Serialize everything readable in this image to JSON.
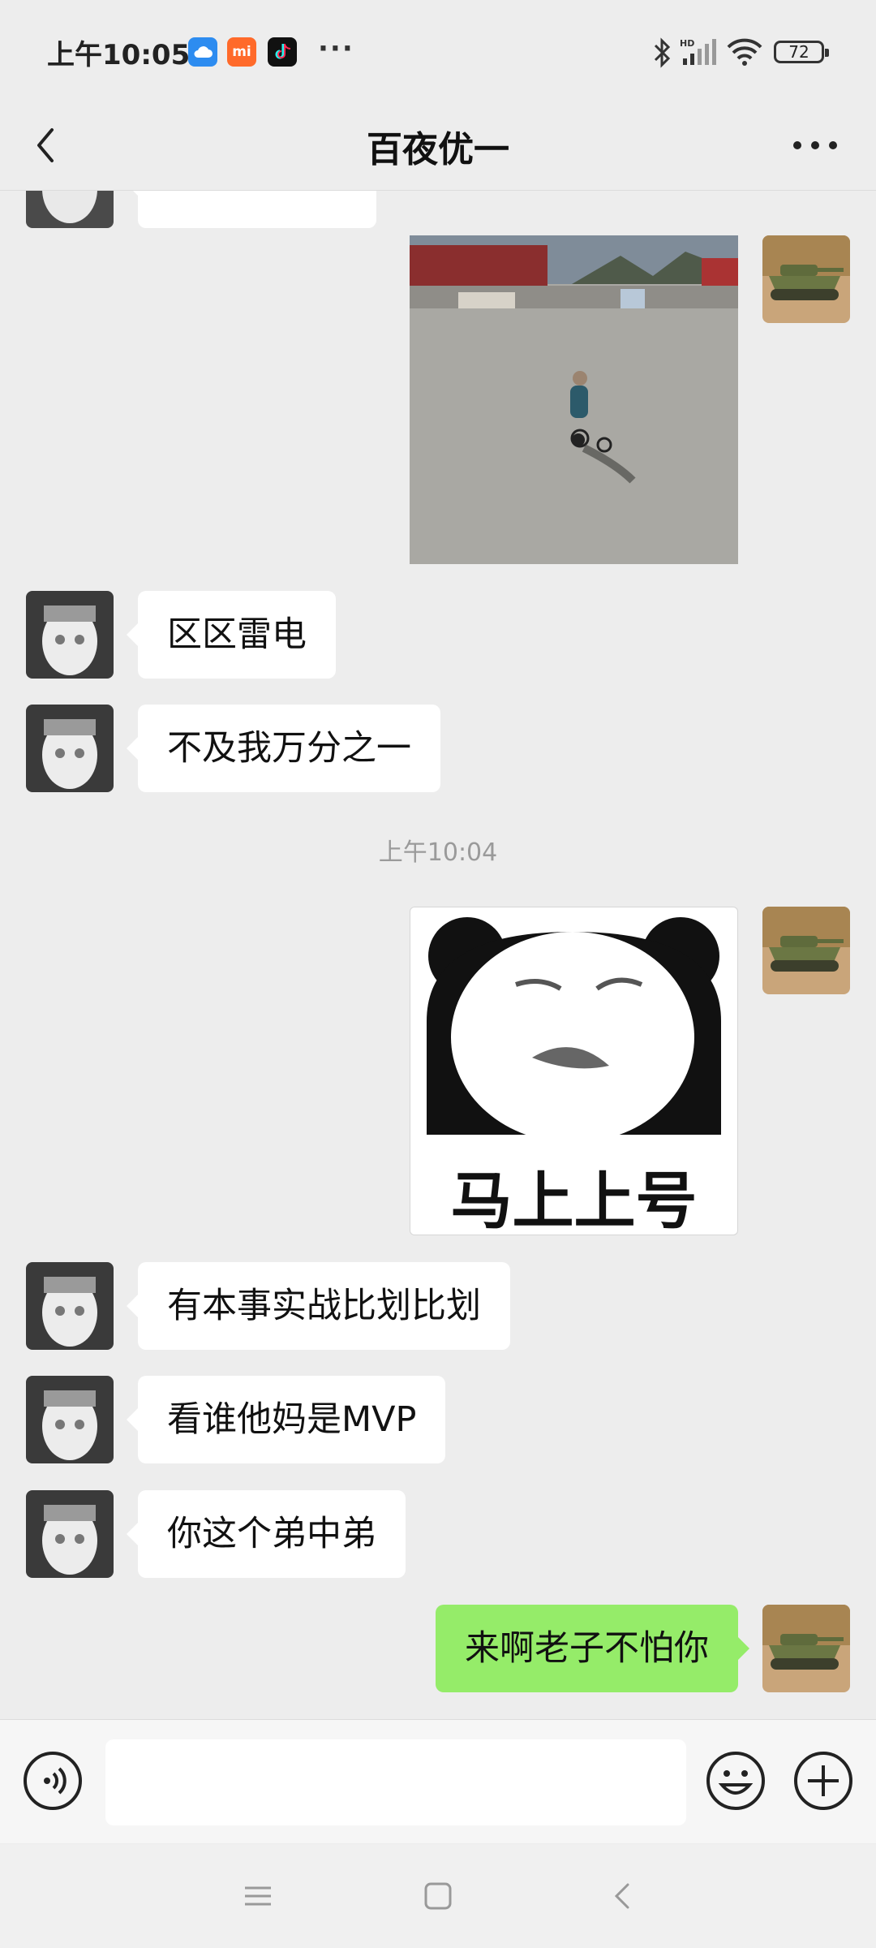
{
  "status_bar": {
    "time": "上午10:05",
    "app_icons": [
      "cloud-icon",
      "mi-icon",
      "tiktok-icon"
    ],
    "mi_label": "mi",
    "battery": "72"
  },
  "header": {
    "title": "百夜优一"
  },
  "messages": [
    {
      "side": "left",
      "text": "区区雷电"
    },
    {
      "side": "left",
      "text": "不及我万分之一"
    },
    {
      "timestamp": "上午10:04"
    },
    {
      "side": "right",
      "sticker_caption": "马上上号"
    },
    {
      "side": "left",
      "text": "有本事实战比划比划"
    },
    {
      "side": "left",
      "text": "看谁他妈是MVP"
    },
    {
      "side": "left",
      "text": "你这个弟中弟"
    },
    {
      "side": "right",
      "text": "来啊老子不怕你"
    }
  ],
  "colors": {
    "background": "#ededed",
    "sent_bubble": "#95ec69",
    "received_bubble": "#ffffff"
  }
}
